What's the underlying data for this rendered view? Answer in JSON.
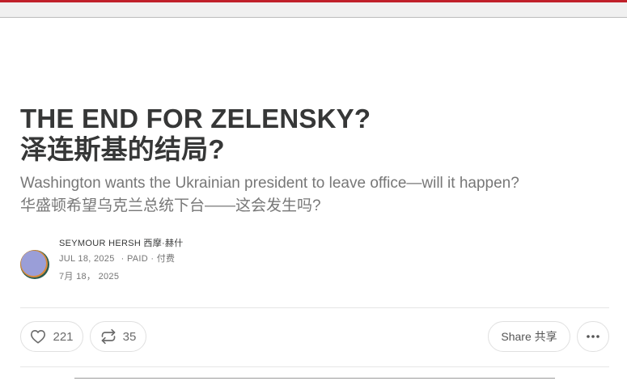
{
  "post": {
    "title_en": "THE END FOR ZELENSKY?",
    "title_cn": "泽连斯基的结局?",
    "subtitle_en": "Washington wants the Ukrainian president to leave office—will it happen?",
    "subtitle_cn": "华盛顿希望乌克兰总统下台——这会发生吗?",
    "author": "SEYMOUR HERSH 西摩·赫什",
    "date": "JUL 18, 2025",
    "paid": "· PAID · 付费",
    "date_cn": "7月 18， 2025"
  },
  "actions": {
    "like_count": "221",
    "restack_count": "35",
    "share_label": "Share 共享"
  },
  "icons": {
    "like": "heart-icon",
    "restack": "restack-icon",
    "more": "more-horizontal-icon"
  },
  "colors": {
    "top_accent": "#c0202a",
    "title": "#363737",
    "subtitle": "#777777"
  }
}
